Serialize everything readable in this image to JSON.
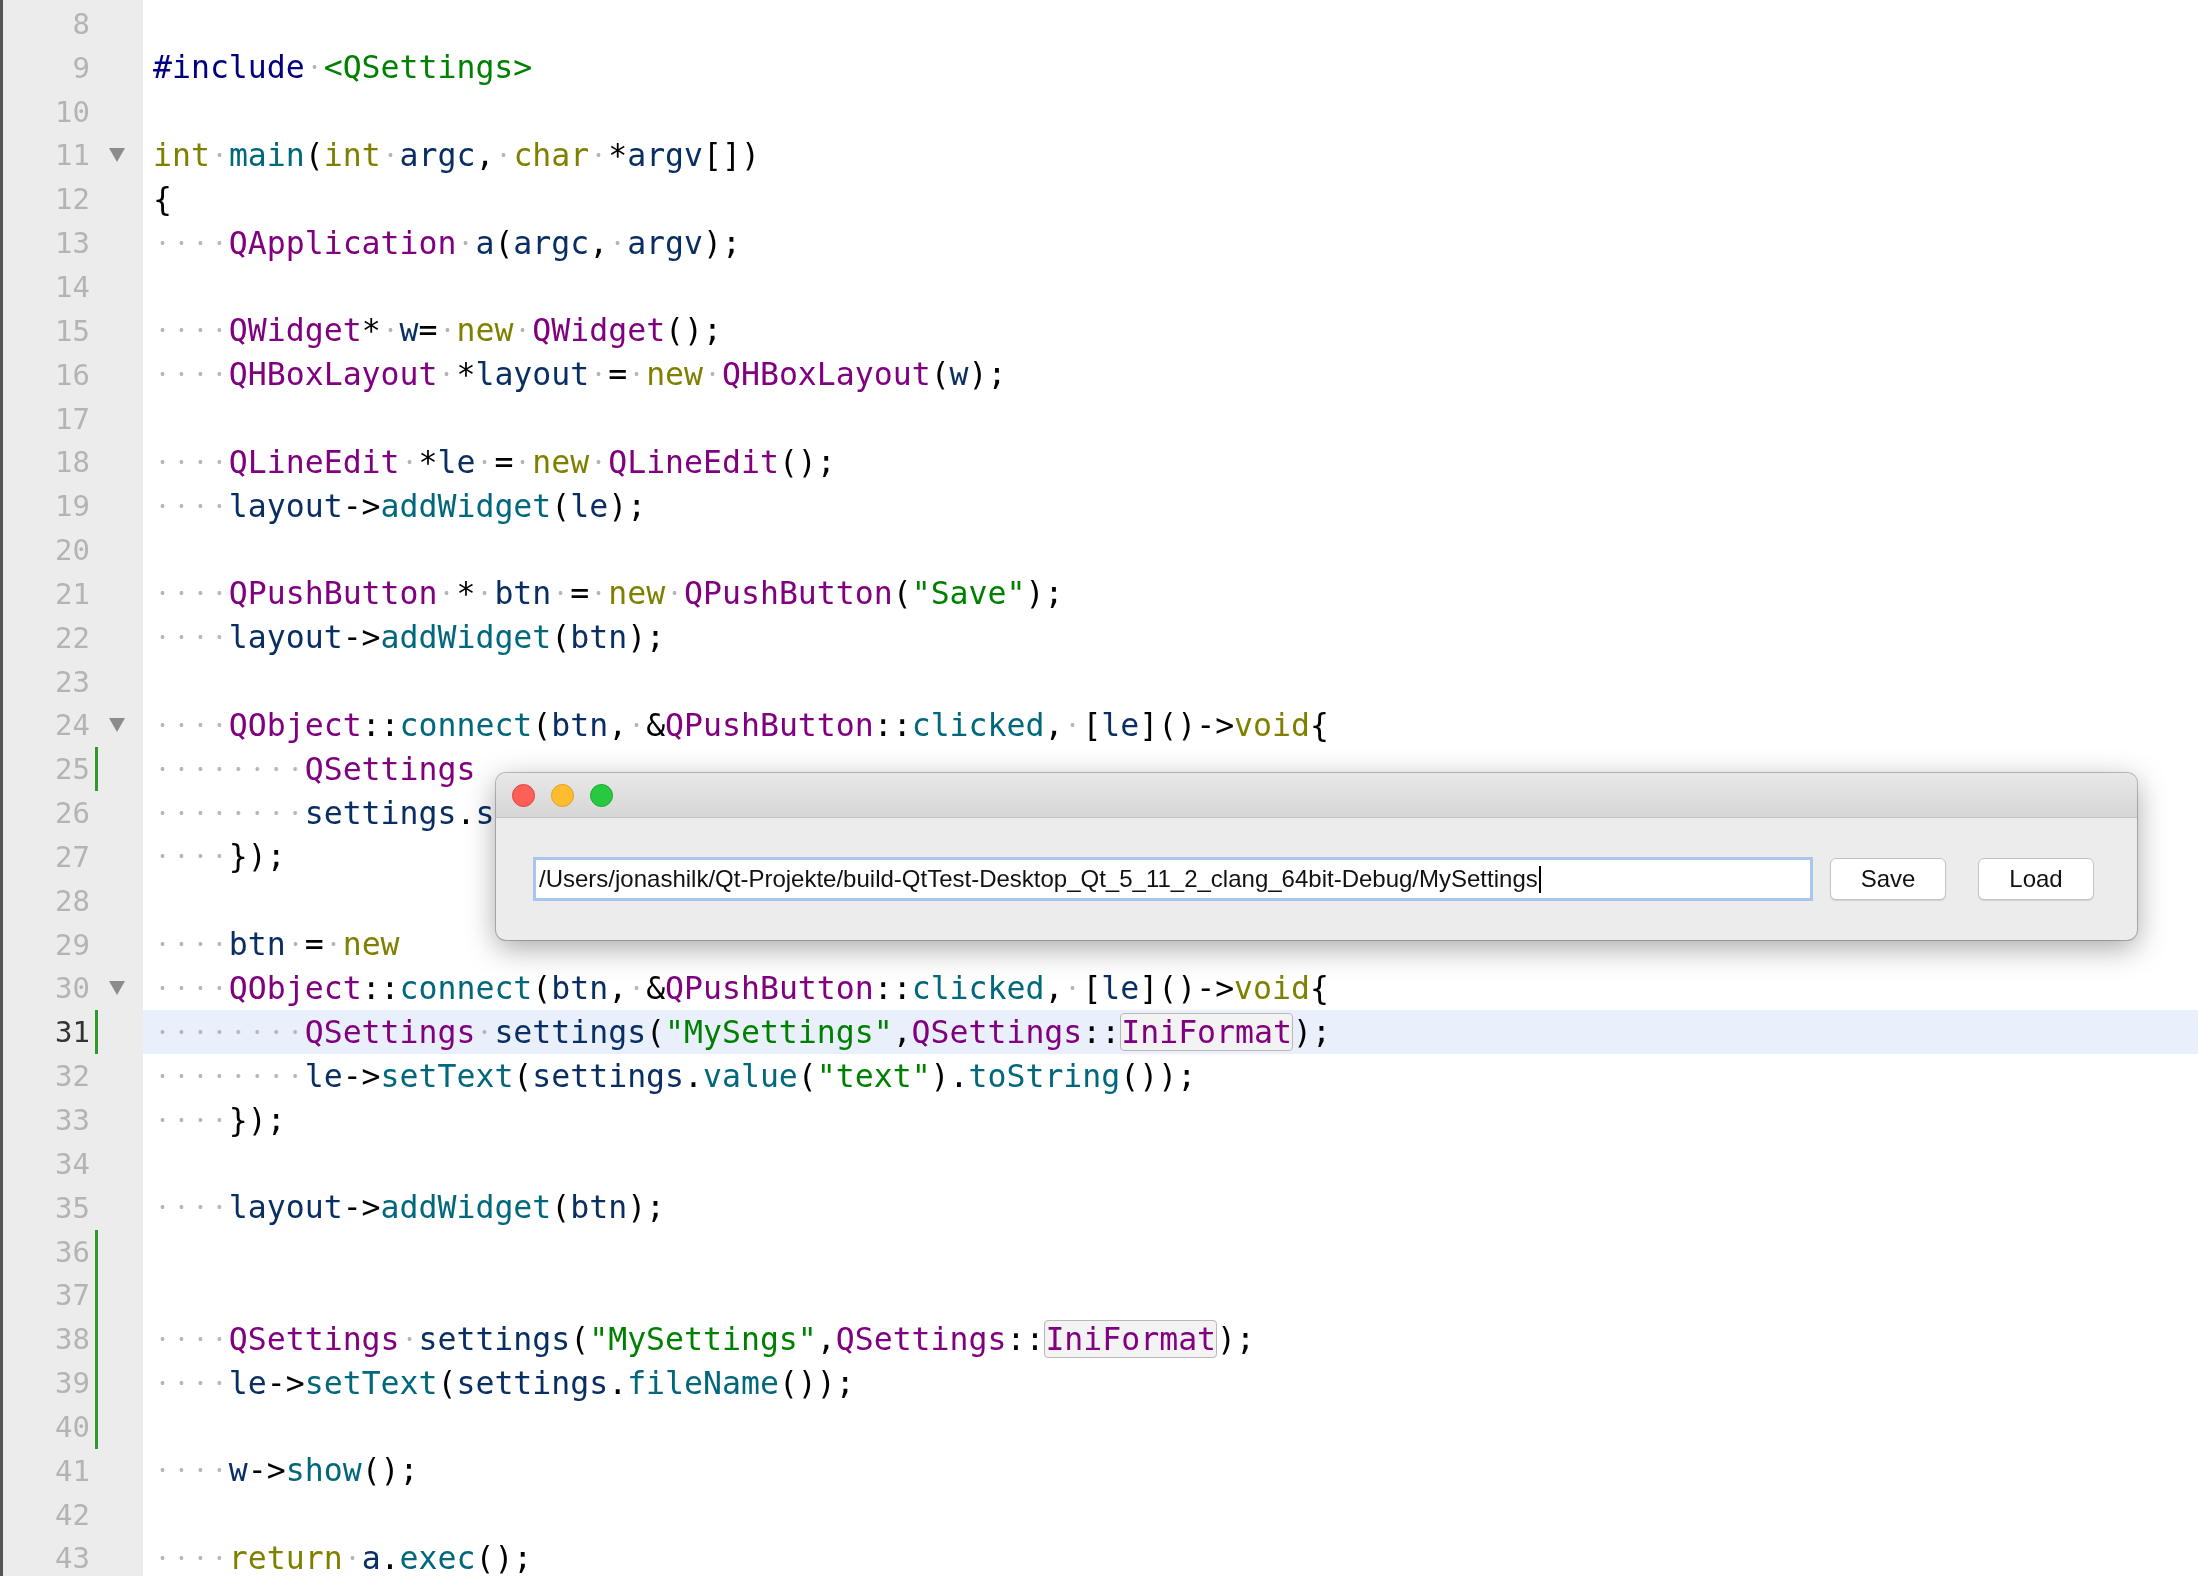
{
  "editor": {
    "lines": [
      {
        "number": "8",
        "fold": false,
        "changed": false,
        "current": false
      },
      {
        "number": "9",
        "fold": false,
        "changed": false,
        "current": false,
        "tokens": [
          {
            "kind": "preprocessor",
            "text": "#include"
          },
          {
            "kind": "string",
            "text": " <QSettings>"
          }
        ]
      },
      {
        "number": "10",
        "fold": false,
        "changed": false,
        "current": false
      },
      {
        "number": "11",
        "fold": true,
        "changed": false,
        "current": false,
        "tokens": [
          {
            "kind": "keyword",
            "text": "int"
          },
          {
            "kind": "function",
            "text": " main"
          },
          {
            "kind": "plain",
            "text": "("
          },
          {
            "kind": "keyword",
            "text": "int"
          },
          {
            "kind": "variable",
            "text": " argc"
          },
          {
            "kind": "plain",
            "text": ", "
          },
          {
            "kind": "keyword",
            "text": "char"
          },
          {
            "kind": "plain",
            "text": " *"
          },
          {
            "kind": "variable",
            "text": "argv"
          },
          {
            "kind": "plain",
            "text": "[])"
          }
        ]
      },
      {
        "number": "12",
        "fold": false,
        "changed": false,
        "current": false,
        "tokens": [
          {
            "kind": "plain",
            "text": "{"
          }
        ]
      },
      {
        "number": "13",
        "fold": false,
        "changed": false,
        "current": false,
        "tokens": [
          {
            "kind": "type",
            "text": "    QApplication"
          },
          {
            "kind": "variable",
            "text": " a"
          },
          {
            "kind": "plain",
            "text": "("
          },
          {
            "kind": "variable",
            "text": "argc"
          },
          {
            "kind": "plain",
            "text": ", "
          },
          {
            "kind": "variable",
            "text": "argv"
          },
          {
            "kind": "plain",
            "text": ");"
          }
        ]
      },
      {
        "number": "14",
        "fold": false,
        "changed": false,
        "current": false
      },
      {
        "number": "15",
        "fold": false,
        "changed": false,
        "current": false,
        "tokens": [
          {
            "kind": "type",
            "text": "    QWidget"
          },
          {
            "kind": "plain",
            "text": "* "
          },
          {
            "kind": "variable",
            "text": "w"
          },
          {
            "kind": "plain",
            "text": "= "
          },
          {
            "kind": "keyword",
            "text": "new"
          },
          {
            "kind": "type",
            "text": " QWidget"
          },
          {
            "kind": "plain",
            "text": "();"
          }
        ]
      },
      {
        "number": "16",
        "fold": false,
        "changed": false,
        "current": false,
        "tokens": [
          {
            "kind": "type",
            "text": "    QHBoxLayout"
          },
          {
            "kind": "plain",
            "text": " *"
          },
          {
            "kind": "variable",
            "text": "layout"
          },
          {
            "kind": "plain",
            "text": " = "
          },
          {
            "kind": "keyword",
            "text": "new"
          },
          {
            "kind": "type",
            "text": " QHBoxLayout"
          },
          {
            "kind": "plain",
            "text": "("
          },
          {
            "kind": "variable",
            "text": "w"
          },
          {
            "kind": "plain",
            "text": ");"
          }
        ]
      },
      {
        "number": "17",
        "fold": false,
        "changed": false,
        "current": false
      },
      {
        "number": "18",
        "fold": false,
        "changed": false,
        "current": false,
        "tokens": [
          {
            "kind": "type",
            "text": "    QLineEdit"
          },
          {
            "kind": "plain",
            "text": " *"
          },
          {
            "kind": "variable",
            "text": "le"
          },
          {
            "kind": "plain",
            "text": " = "
          },
          {
            "kind": "keyword",
            "text": "new"
          },
          {
            "kind": "type",
            "text": " QLineEdit"
          },
          {
            "kind": "plain",
            "text": "();"
          }
        ]
      },
      {
        "number": "19",
        "fold": false,
        "changed": false,
        "current": false,
        "tokens": [
          {
            "kind": "variable",
            "text": "    layout"
          },
          {
            "kind": "plain",
            "text": "->"
          },
          {
            "kind": "function",
            "text": "addWidget"
          },
          {
            "kind": "plain",
            "text": "("
          },
          {
            "kind": "variable",
            "text": "le"
          },
          {
            "kind": "plain",
            "text": ");"
          }
        ]
      },
      {
        "number": "20",
        "fold": false,
        "changed": false,
        "current": false
      },
      {
        "number": "21",
        "fold": false,
        "changed": false,
        "current": false,
        "tokens": [
          {
            "kind": "type",
            "text": "    QPushButton"
          },
          {
            "kind": "plain",
            "text": " * "
          },
          {
            "kind": "variable",
            "text": "btn"
          },
          {
            "kind": "plain",
            "text": " = "
          },
          {
            "kind": "keyword",
            "text": "new"
          },
          {
            "kind": "type",
            "text": " QPushButton"
          },
          {
            "kind": "plain",
            "text": "("
          },
          {
            "kind": "string",
            "text": "\"Save\""
          },
          {
            "kind": "plain",
            "text": ");"
          }
        ]
      },
      {
        "number": "22",
        "fold": false,
        "changed": false,
        "current": false,
        "tokens": [
          {
            "kind": "variable",
            "text": "    layout"
          },
          {
            "kind": "plain",
            "text": "->"
          },
          {
            "kind": "function",
            "text": "addWidget"
          },
          {
            "kind": "plain",
            "text": "("
          },
          {
            "kind": "variable",
            "text": "btn"
          },
          {
            "kind": "plain",
            "text": ");"
          }
        ]
      },
      {
        "number": "23",
        "fold": false,
        "changed": false,
        "current": false
      },
      {
        "number": "24",
        "fold": true,
        "changed": false,
        "current": false,
        "tokens": [
          {
            "kind": "type",
            "text": "    QObject"
          },
          {
            "kind": "plain",
            "text": "::"
          },
          {
            "kind": "function",
            "text": "connect"
          },
          {
            "kind": "plain",
            "text": "("
          },
          {
            "kind": "variable",
            "text": "btn"
          },
          {
            "kind": "plain",
            "text": ", &"
          },
          {
            "kind": "type",
            "text": "QPushButton"
          },
          {
            "kind": "plain",
            "text": "::"
          },
          {
            "kind": "function",
            "text": "clicked"
          },
          {
            "kind": "plain",
            "text": ", ["
          },
          {
            "kind": "variable",
            "text": "le"
          },
          {
            "kind": "plain",
            "text": "]()->"
          },
          {
            "kind": "keyword",
            "text": "void"
          },
          {
            "kind": "plain",
            "text": "{"
          }
        ]
      },
      {
        "number": "25",
        "fold": false,
        "changed": true,
        "current": false,
        "tokens": [
          {
            "kind": "type",
            "text": "        QSettings"
          }
        ]
      },
      {
        "number": "26",
        "fold": false,
        "changed": false,
        "current": false,
        "tokens": [
          {
            "kind": "variable",
            "text": "        settings"
          },
          {
            "kind": "plain",
            "text": "."
          },
          {
            "kind": "variable",
            "text": "s"
          }
        ]
      },
      {
        "number": "27",
        "fold": false,
        "changed": false,
        "current": false,
        "tokens": [
          {
            "kind": "plain",
            "text": "    });"
          }
        ]
      },
      {
        "number": "28",
        "fold": false,
        "changed": false,
        "current": false
      },
      {
        "number": "29",
        "fold": false,
        "changed": false,
        "current": false,
        "tokens": [
          {
            "kind": "variable",
            "text": "    btn"
          },
          {
            "kind": "plain",
            "text": " = "
          },
          {
            "kind": "keyword",
            "text": "new"
          }
        ]
      },
      {
        "number": "30",
        "fold": true,
        "changed": false,
        "current": false,
        "tokens": [
          {
            "kind": "type",
            "text": "    QObject"
          },
          {
            "kind": "plain",
            "text": "::"
          },
          {
            "kind": "function",
            "text": "connect"
          },
          {
            "kind": "plain",
            "text": "("
          },
          {
            "kind": "variable",
            "text": "btn"
          },
          {
            "kind": "plain",
            "text": ", &"
          },
          {
            "kind": "type",
            "text": "QPushButton"
          },
          {
            "kind": "plain",
            "text": "::"
          },
          {
            "kind": "function",
            "text": "clicked"
          },
          {
            "kind": "plain",
            "text": ", ["
          },
          {
            "kind": "variable",
            "text": "le"
          },
          {
            "kind": "plain",
            "text": "]()->"
          },
          {
            "kind": "keyword",
            "text": "void"
          },
          {
            "kind": "plain",
            "text": "{"
          }
        ]
      },
      {
        "number": "31",
        "fold": false,
        "changed": true,
        "current": true,
        "tokens": [
          {
            "kind": "type",
            "text": "        QSettings"
          },
          {
            "kind": "variable",
            "text": " settings"
          },
          {
            "kind": "plain",
            "text": "("
          },
          {
            "kind": "string",
            "text": "\"MySettings\""
          },
          {
            "kind": "plain",
            "text": ","
          },
          {
            "kind": "type",
            "text": "QSettings"
          },
          {
            "kind": "plain",
            "text": "::"
          },
          {
            "kind": "highlighted",
            "text": "IniFormat"
          },
          {
            "kind": "plain",
            "text": ");"
          }
        ]
      },
      {
        "number": "32",
        "fold": false,
        "changed": false,
        "current": false,
        "tokens": [
          {
            "kind": "variable",
            "text": "        le"
          },
          {
            "kind": "plain",
            "text": "->"
          },
          {
            "kind": "function",
            "text": "setText"
          },
          {
            "kind": "plain",
            "text": "("
          },
          {
            "kind": "variable",
            "text": "settings"
          },
          {
            "kind": "plain",
            "text": "."
          },
          {
            "kind": "function",
            "text": "value"
          },
          {
            "kind": "plain",
            "text": "("
          },
          {
            "kind": "string",
            "text": "\"text\""
          },
          {
            "kind": "plain",
            "text": ")."
          },
          {
            "kind": "function",
            "text": "toString"
          },
          {
            "kind": "plain",
            "text": "());"
          }
        ]
      },
      {
        "number": "33",
        "fold": false,
        "changed": false,
        "current": false,
        "tokens": [
          {
            "kind": "plain",
            "text": "    });"
          }
        ]
      },
      {
        "number": "34",
        "fold": false,
        "changed": false,
        "current": false
      },
      {
        "number": "35",
        "fold": false,
        "changed": false,
        "current": false,
        "tokens": [
          {
            "kind": "variable",
            "text": "    layout"
          },
          {
            "kind": "plain",
            "text": "->"
          },
          {
            "kind": "function",
            "text": "addWidget"
          },
          {
            "kind": "plain",
            "text": "("
          },
          {
            "kind": "variable",
            "text": "btn"
          },
          {
            "kind": "plain",
            "text": ");"
          }
        ]
      },
      {
        "number": "36",
        "fold": false,
        "changed": true,
        "current": false
      },
      {
        "number": "37",
        "fold": false,
        "changed": true,
        "current": false
      },
      {
        "number": "38",
        "fold": false,
        "changed": true,
        "current": false,
        "tokens": [
          {
            "kind": "type",
            "text": "    QSettings"
          },
          {
            "kind": "variable",
            "text": " settings"
          },
          {
            "kind": "plain",
            "text": "("
          },
          {
            "kind": "string",
            "text": "\"MySettings\""
          },
          {
            "kind": "plain",
            "text": ","
          },
          {
            "kind": "type",
            "text": "QSettings"
          },
          {
            "kind": "plain",
            "text": "::"
          },
          {
            "kind": "highlighted",
            "text": "IniFormat"
          },
          {
            "kind": "plain",
            "text": ");"
          }
        ]
      },
      {
        "number": "39",
        "fold": false,
        "changed": true,
        "current": false,
        "tokens": [
          {
            "kind": "variable",
            "text": "    le"
          },
          {
            "kind": "plain",
            "text": "->"
          },
          {
            "kind": "function",
            "text": "setText"
          },
          {
            "kind": "plain",
            "text": "("
          },
          {
            "kind": "variable",
            "text": "settings"
          },
          {
            "kind": "plain",
            "text": "."
          },
          {
            "kind": "function",
            "text": "fileName"
          },
          {
            "kind": "plain",
            "text": "());"
          }
        ]
      },
      {
        "number": "40",
        "fold": false,
        "changed": true,
        "current": false
      },
      {
        "number": "41",
        "fold": false,
        "changed": false,
        "current": false,
        "tokens": [
          {
            "kind": "variable",
            "text": "    w"
          },
          {
            "kind": "plain",
            "text": "->"
          },
          {
            "kind": "function",
            "text": "show"
          },
          {
            "kind": "plain",
            "text": "();"
          }
        ]
      },
      {
        "number": "42",
        "fold": false,
        "changed": false,
        "current": false
      },
      {
        "number": "43",
        "fold": false,
        "changed": false,
        "current": false,
        "tokens": [
          {
            "kind": "keyword",
            "text": "    return"
          },
          {
            "kind": "variable",
            "text": " a"
          },
          {
            "kind": "plain",
            "text": "."
          },
          {
            "kind": "function",
            "text": "exec"
          },
          {
            "kind": "plain",
            "text": "();"
          }
        ]
      }
    ]
  },
  "dialog": {
    "path_field": {
      "value": "/Users/jonashilk/Qt-Projekte/build-QtTest-Desktop_Qt_5_11_2_clang_64bit-Debug/MySettings"
    },
    "buttons": [
      "Save",
      "Load"
    ]
  }
}
